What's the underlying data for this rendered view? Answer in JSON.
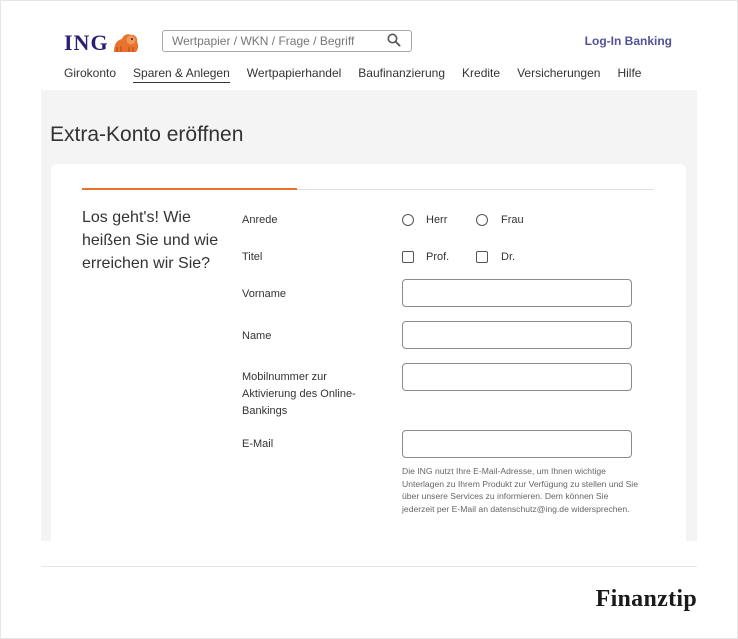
{
  "header": {
    "logo_text": "ING",
    "search_placeholder": "Wertpapier / WKN / Frage / Begriff",
    "login_label": "Log-In Banking"
  },
  "nav": {
    "items": [
      "Girokonto",
      "Sparen & Anlegen",
      "Wertpapierhandel",
      "Baufinanzierung",
      "Kredite",
      "Versicherungen",
      "Hilfe"
    ],
    "active_index": 1
  },
  "page": {
    "title": "Extra-Konto eröffnen"
  },
  "form": {
    "progress_fraction": 0.375,
    "intro": "Los geht's! Wie heißen Sie und wie erreichen wir Sie?",
    "anrede_label": "Anrede",
    "anrede_options": [
      "Herr",
      "Frau"
    ],
    "titel_label": "Titel",
    "titel_options": [
      "Prof.",
      "Dr."
    ],
    "vorname_label": "Vorname",
    "vorname_value": "",
    "name_label": "Name",
    "name_value": "",
    "mobil_label": "Mobilnummer zur Aktivierung des Online-Bankings",
    "mobil_value": "",
    "email_label": "E-Mail",
    "email_value": "",
    "email_hint": "Die ING nutzt Ihre E-Mail-Adresse, um Ihnen wichtige Unterlagen zu Ihrem Produkt zur Verfügung zu stellen und Sie über unsere Services zu informieren. Dem können Sie jederzeit per E-Mail an datenschutz@ing.de widersprechen."
  },
  "footer": {
    "brand": "Finanztip"
  },
  "colors": {
    "ing_blue": "#2c1f72",
    "ing_orange": "#e8732f",
    "link_purple": "#525199",
    "background_gray": "#f4f4f4"
  }
}
